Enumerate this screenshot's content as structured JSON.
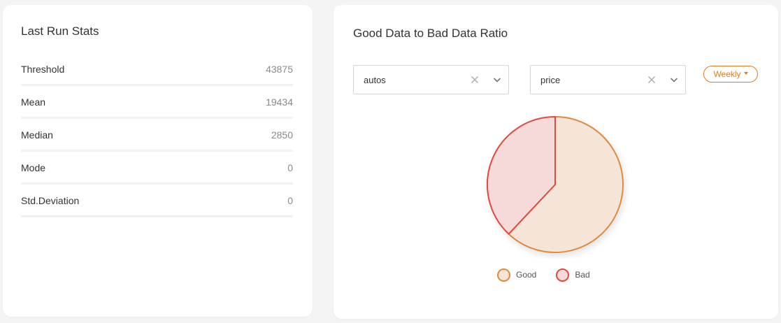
{
  "stats": {
    "title": "Last Run Stats",
    "rows": [
      {
        "label": "Threshold",
        "value": "43875"
      },
      {
        "label": "Mean",
        "value": "19434"
      },
      {
        "label": "Median",
        "value": "2850"
      },
      {
        "label": "Mode",
        "value": "0"
      },
      {
        "label": "Std.Deviation",
        "value": "0"
      }
    ]
  },
  "ratio": {
    "title": "Good Data to Bad Data Ratio",
    "select_dataset": {
      "value": "autos"
    },
    "select_column": {
      "value": "price"
    },
    "period_button": {
      "label": "Weekly"
    },
    "icons": {
      "clear": "close-icon",
      "expand": "chevron-down-icon",
      "caret": "caret-down-icon"
    }
  },
  "colors": {
    "good_stroke": "#e08a3c",
    "good_fill": "#f5e5d8",
    "bad_stroke": "#e04a3c",
    "bad_fill": "#f6d9d9",
    "accent": "#e07b22"
  },
  "chart_data": {
    "type": "pie",
    "labels": [
      "Good",
      "Bad"
    ],
    "values": [
      62,
      38
    ],
    "legend": "bottom"
  }
}
